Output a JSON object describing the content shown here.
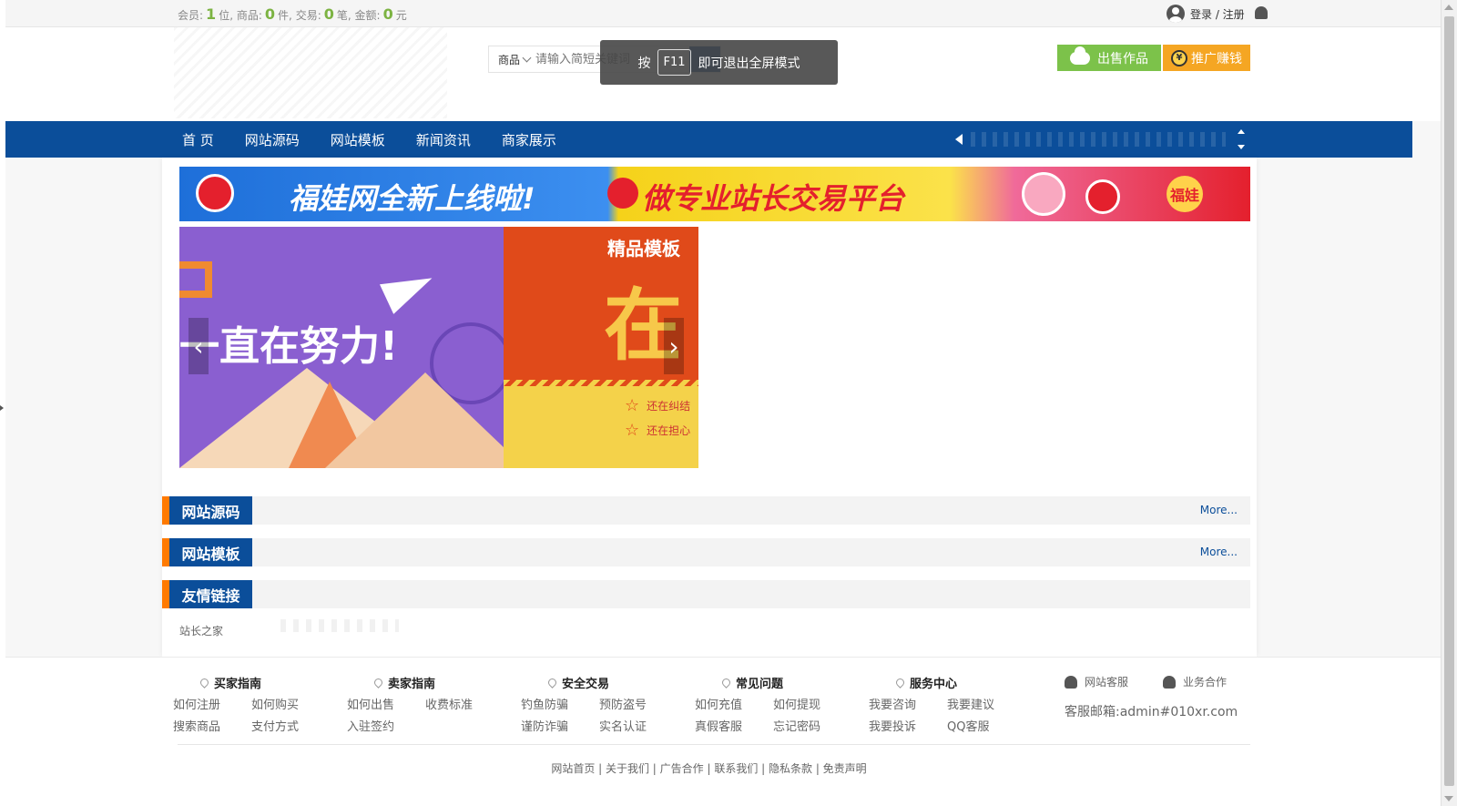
{
  "topbar": {
    "stats": [
      {
        "label": "会员:",
        "value": "1",
        "unit": "位,"
      },
      {
        "label": "商品:",
        "value": "0",
        "unit": "件,"
      },
      {
        "label": "交易:",
        "value": "0",
        "unit": "笔,"
      },
      {
        "label": "金额:",
        "value": "0",
        "unit": "元"
      }
    ],
    "login_label": "登录 / 注册"
  },
  "search": {
    "category": "商品",
    "placeholder": "请输入简短关键词"
  },
  "header_buttons": {
    "sell_label": "出售作品",
    "promo_label": "推广赚钱",
    "promo_icon_text": "¥"
  },
  "toast": {
    "prefix": "按",
    "key": "F11",
    "suffix": "即可退出全屏模式"
  },
  "nav": {
    "items": [
      "首 页",
      "网站源码",
      "网站模板",
      "新闻资讯",
      "商家展示"
    ]
  },
  "banner": {
    "text_left": "福娃网全新上线啦!",
    "text_mid": "做专业站长交易平台",
    "badge": "福娃"
  },
  "slider": {
    "slide1_text": "一直在努力!",
    "slide2_title": "精品模板",
    "slide2_big": "在",
    "slide2_lines": [
      "还在纠结",
      "还在担心"
    ],
    "prev_label": "‹",
    "next_label": "›"
  },
  "sections": [
    {
      "title": "网站源码",
      "more": "More..."
    },
    {
      "title": "网站模板",
      "more": "More..."
    },
    {
      "title": "友情链接",
      "more": ""
    }
  ],
  "friend_links": [
    "站长之家"
  ],
  "footer": {
    "columns": [
      {
        "title": "买家指南",
        "links": [
          "如何注册",
          "如何购买",
          "搜索商品",
          "支付方式"
        ]
      },
      {
        "title": "卖家指南",
        "links": [
          "如何出售",
          "收费标准",
          "入驻签约"
        ]
      },
      {
        "title": "安全交易",
        "links": [
          "钓鱼防骗",
          "预防盗号",
          "谨防诈骗",
          "实名认证"
        ]
      },
      {
        "title": "常见问题",
        "links": [
          "如何充值",
          "如何提现",
          "真假客服",
          "忘记密码"
        ]
      },
      {
        "title": "服务中心",
        "links": [
          "我要咨询",
          "我要建议",
          "我要投诉",
          "QQ客服"
        ]
      }
    ],
    "contact": {
      "service_label": "网站客服",
      "business_label": "业务合作",
      "email": "客服邮箱:admin#010xr.com"
    },
    "bottom_links": "网站首页 | 关于我们 | 广告合作 | 联系我们 | 隐私条款 | 免责声明"
  }
}
